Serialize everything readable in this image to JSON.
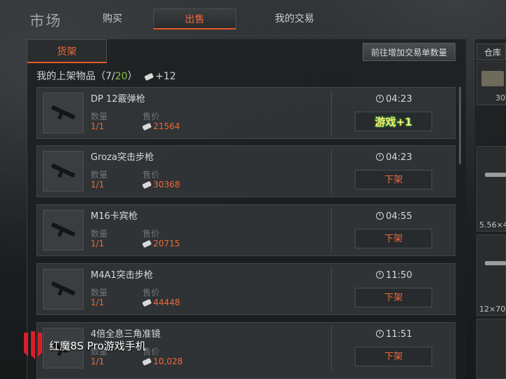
{
  "header": {
    "title": "市场",
    "tabs": [
      "购买",
      "出售",
      "我的交易"
    ]
  },
  "shelf": {
    "tab": "货架",
    "add_button": "前往增加交易单数量",
    "listed_label": "我的上架物品（",
    "listed_count": "7",
    "listed_sep": "/",
    "listed_max": "20",
    "listed_close": "）",
    "bonus": "+12",
    "qty_label": "数量",
    "price_label": "售价",
    "unlist_label": "下架"
  },
  "items": [
    {
      "name": "DP 12霰弹枪",
      "qty": "1/1",
      "price": "21564",
      "time": "04:23",
      "action": "游戏+1"
    },
    {
      "name": "Groza突击步枪",
      "qty": "1/1",
      "price": "30368",
      "time": "04:23",
      "action": "下架"
    },
    {
      "name": "M16卡宾枪",
      "qty": "1/1",
      "price": "20715",
      "time": "04:55",
      "action": "下架"
    },
    {
      "name": "M4A1突击步枪",
      "qty": "1/1",
      "price": "44448",
      "time": "11:50",
      "action": "下架"
    },
    {
      "name": "4倍全息三角准镜",
      "qty": "1/1",
      "price": "10,028",
      "time": "11:51",
      "action": "下架"
    }
  ],
  "warehouse": {
    "tab": "仓库",
    "slot_value": "30",
    "label_1": "5.56×4",
    "label_2": "12×70"
  },
  "watermark": {
    "text": "红魔8S Pro游戏手机"
  },
  "colors": {
    "accent": "#e25a2a",
    "price": "#ea6a3c",
    "green": "#8ac24a"
  }
}
